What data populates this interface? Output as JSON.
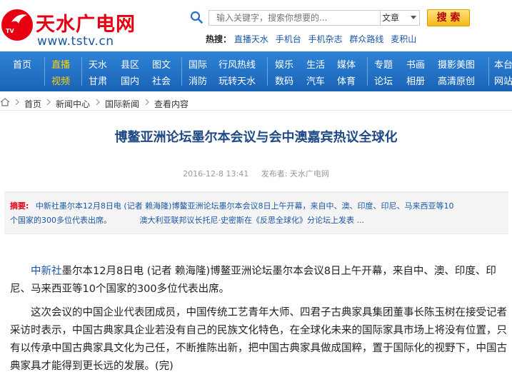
{
  "header": {
    "logo_name": "天水广电网",
    "logo_url": "www.tstv.cn",
    "logo_badge": "TV",
    "search": {
      "placeholder": "输入关键字，搜索你想要的...",
      "select_value": "文章",
      "button_label": "搜 索"
    },
    "hot": {
      "label": "热搜：",
      "links": [
        "直播天水",
        "手机台",
        "手机杂志",
        "群众路线",
        "麦积山"
      ]
    }
  },
  "nav": {
    "groups": [
      {
        "top": [
          "首页"
        ],
        "bottom": []
      },
      {
        "top": [
          "直播"
        ],
        "bottom": [
          "视频"
        ]
      },
      {
        "top": [
          "天水",
          "县区",
          "图文"
        ],
        "bottom": [
          "甘肃",
          "国内",
          "社会"
        ]
      },
      {
        "top": [
          "国际",
          "行风热线"
        ],
        "bottom": [
          "消防",
          "玩转天水"
        ]
      },
      {
        "top": [
          "娱乐",
          "生活",
          "媒体"
        ],
        "bottom": [
          "数码",
          "汽车",
          "体育"
        ]
      },
      {
        "top": [
          "专题",
          "书画",
          "摄影美图"
        ],
        "bottom": [
          "论坛",
          "相册",
          "高清原创"
        ]
      },
      {
        "top": [
          "本台"
        ],
        "bottom": [
          "网站"
        ]
      }
    ]
  },
  "breadcrumb": [
    "首页",
    "新闻中心",
    "国际新闻",
    "查看内容"
  ],
  "article": {
    "title": "博鳌亚洲论坛墨尔本会议与会中澳嘉宾热议全球化",
    "date": "2016-12-8 13:41",
    "publisher": "发布者: 天水广电网",
    "summary_label": "摘要:",
    "summary_text_line1": "中新社墨尔本12月8日电 (记者 赖海隆)博鳌亚洲论坛墨尔本会议8日上午开幕，来自中、澳、印度、印尼、马来西亚等10",
    "summary_text_line2": "个国家的300多位代表出席。",
    "summary_more": "澳大利亚联邦议长托尼·史密斯在《反思全球化》分论坛上发表 ...",
    "para1_source": "中新社",
    "para1_rest": "墨尔本12月8日电 (记者 赖海隆)博鳌亚洲论坛墨尔本会议8日上午开幕，来自中、澳、印度、印尼、马来西亚等10个国家的300多位代表出席。",
    "para2": "这次会议的中国企业代表团成员，中国传统工艺青年大师、四君子古典家具集团董事长陈玉树在接受记者采访时表示，中国古典家具企业若没有自己的民族文化特色，在全球化未来的国际家具市场上将没有位置，只有以传承中国古典家具文化为己任，不断推陈出新，把中国古典家具做成国粹，置于国际化的视野下，中国古典家具才能得到更长远的发展。(完)"
  },
  "colors": {
    "brand_red": "#e60012",
    "nav_blue": "#1a63b6",
    "link_blue": "#1a56a4",
    "active_yellow": "#ffd200"
  }
}
